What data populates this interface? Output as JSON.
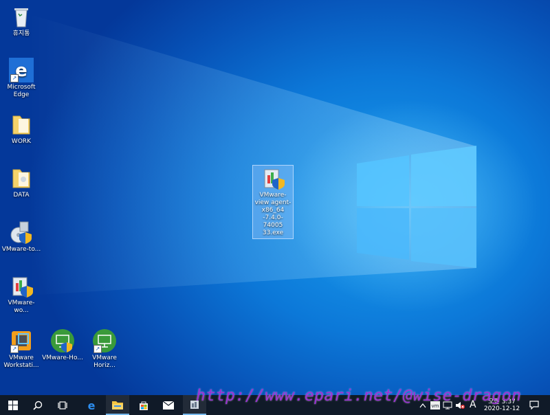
{
  "desktop": {
    "icons": [
      {
        "label": "휴지통",
        "icon": "recycle-bin-icon"
      },
      {
        "label": "Microsoft Edge",
        "icon": "edge-icon"
      },
      {
        "label": "WORK",
        "icon": "folder-icon"
      },
      {
        "label": "DATA",
        "icon": "folder-icon"
      },
      {
        "label": "VMware-to...",
        "icon": "vmware-tools-installer-icon"
      },
      {
        "label": "VMware-wo...",
        "icon": "vmware-workstation-installer-icon"
      },
      {
        "label": "VMware Workstati...",
        "icon": "vmware-workstation-icon"
      },
      {
        "label": "VMware-Ho...",
        "icon": "vmware-horizon-client-icon"
      },
      {
        "label": "VMware Horiz...",
        "icon": "vmware-horizon-icon"
      }
    ],
    "selected_file": {
      "label": "VMware-view agent-x86_64 -7.4.0-74005 33.exe",
      "icon": "vmware-installer-icon"
    }
  },
  "taskbar": {
    "buttons": [
      "start-icon",
      "search-icon",
      "task-view-icon",
      "edge-icon",
      "file-explorer-icon",
      "store-icon",
      "mail-icon",
      "installer-icon"
    ],
    "tray": {
      "ime": "A",
      "time": "오전 3:37",
      "date": "2020-12-12"
    }
  },
  "watermark": "http://www.epari.net/@wise-dragon",
  "colors": {
    "desktop_blue": "#0c78d8",
    "taskbar": "#101a28",
    "watermark": "#9b2fd6"
  }
}
